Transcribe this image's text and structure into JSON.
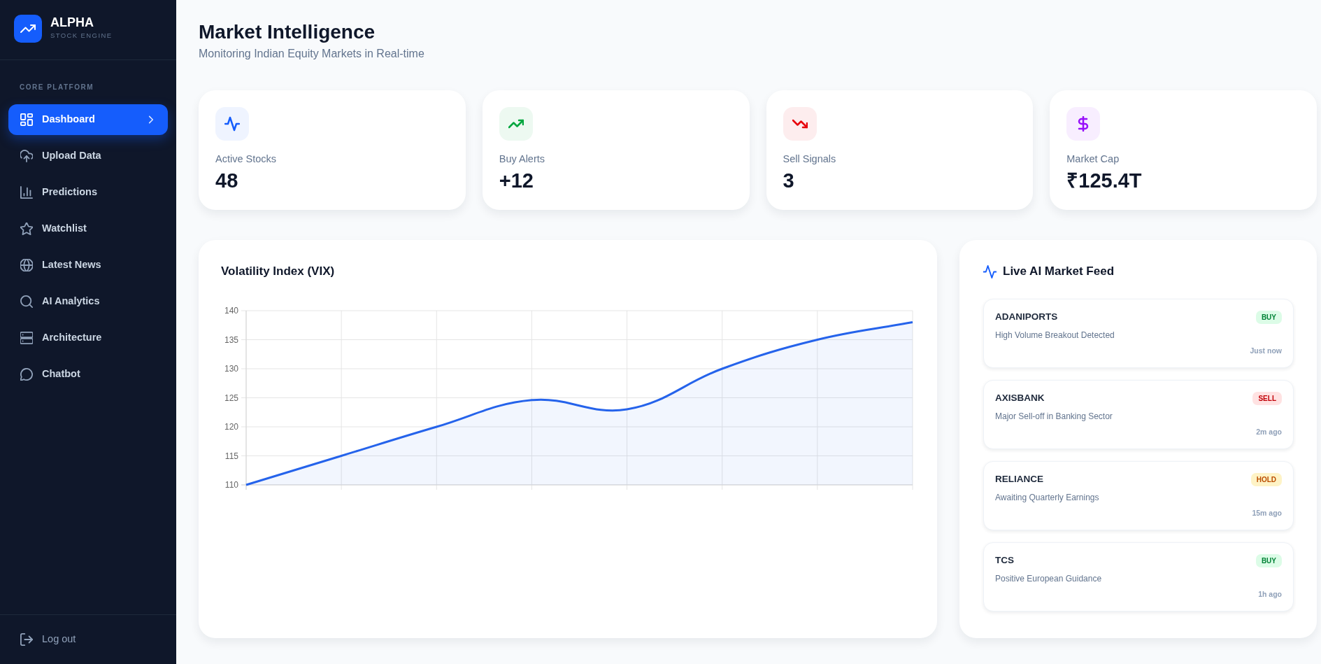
{
  "sidebar": {
    "brand": {
      "title": "ALPHA",
      "subtitle": "STOCK ENGINE"
    },
    "section_label": "CORE PLATFORM",
    "items": [
      {
        "label": "Dashboard",
        "selected": true
      },
      {
        "label": "Upload Data",
        "selected": false
      },
      {
        "label": "Predictions",
        "selected": false
      },
      {
        "label": "Watchlist",
        "selected": false
      },
      {
        "label": "Latest News",
        "selected": false
      },
      {
        "label": "AI Analytics",
        "selected": false
      },
      {
        "label": "Architecture",
        "selected": false
      },
      {
        "label": "Chatbot",
        "selected": false
      }
    ],
    "footer_item": {
      "label": "Log out"
    }
  },
  "header": {
    "title": "Market Intelligence",
    "subtitle": "Monitoring Indian Equity Markets in Real-time"
  },
  "stats": [
    {
      "label": "Active Stocks",
      "value": "48",
      "color": "#155dfc"
    },
    {
      "label": "Buy Alerts",
      "value": "+12",
      "color": "#00a63e"
    },
    {
      "label": "Sell Signals",
      "value": "3",
      "color": "#e7000b"
    },
    {
      "label": "Market Cap",
      "value": "₹125.4T",
      "color": "#9810fa"
    }
  ],
  "volatility_card": {
    "chart_data": {
      "type": "area",
      "title": "Volatility Index (VIX)",
      "series": [
        {
          "color": "#2563eb",
          "values": [
            110,
            115,
            120,
            124.6,
            123,
            130,
            135,
            138
          ]
        }
      ],
      "ylim": [
        110,
        140
      ],
      "yticks": [
        110,
        115,
        120,
        125,
        130,
        135,
        140
      ],
      "grid": true
    }
  },
  "feed": {
    "title": "Live AI Market Feed",
    "items": [
      {
        "symbol": "ADANIPORTS",
        "badge": "BUY",
        "kind": "buy",
        "message": "High Volume Breakout Detected",
        "time": "Just now"
      },
      {
        "symbol": "AXISBANK",
        "badge": "SELL",
        "kind": "sell",
        "message": "Major Sell-off in Banking Sector",
        "time": "2m ago"
      },
      {
        "symbol": "RELIANCE",
        "badge": "HOLD",
        "kind": "hold",
        "message": "Awaiting Quarterly Earnings",
        "time": "15m ago"
      },
      {
        "symbol": "TCS",
        "badge": "BUY",
        "kind": "buy",
        "message": "Positive European Guidance",
        "time": "1h ago"
      }
    ]
  }
}
